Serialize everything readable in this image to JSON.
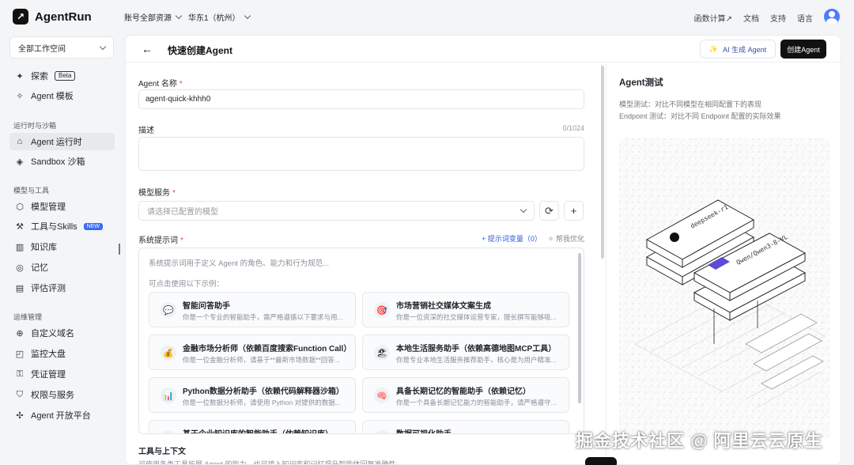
{
  "app": {
    "name": "AgentRun"
  },
  "topbar": {
    "account_scope": "账号全部资源",
    "region": "华东1（杭州）",
    "links": [
      "函数计算↗",
      "文档",
      "支持",
      "语言"
    ]
  },
  "sidebar": {
    "workspace": "全部工作空间",
    "items": [
      {
        "label": "探索",
        "badge": "Beta"
      },
      {
        "label": "Agent 模板"
      }
    ],
    "section_runtime": "运行时与沙箱",
    "runtime_items": [
      {
        "label": "Agent 运行时"
      },
      {
        "label": "Sandbox 沙箱"
      }
    ],
    "section_models": "模型与工具",
    "model_items": [
      {
        "label": "模型管理"
      },
      {
        "label": "工具与Skills",
        "badge": "NEW"
      },
      {
        "label": "知识库"
      },
      {
        "label": "记忆"
      },
      {
        "label": "评估评测"
      }
    ],
    "section_ops": "运维管理",
    "ops_items": [
      {
        "label": "自定义域名"
      },
      {
        "label": "监控大盘"
      },
      {
        "label": "凭证管理"
      },
      {
        "label": "权限与服务"
      },
      {
        "label": "Agent 开放平台"
      }
    ]
  },
  "header": {
    "title": "快速创建Agent",
    "ai_button": "AI 生成 Agent",
    "create_button": "创建Agent"
  },
  "form": {
    "name_label": "Agent 名称",
    "name_value": "agent-quick-khhh0",
    "desc_label": "描述",
    "desc_counter": "0/1024",
    "model_label": "模型服务",
    "model_placeholder": "请选择已配置的模型",
    "prompt_label": "系统提示词",
    "prompt_var_link": "+ 提示词变量（0）",
    "prompt_optimize_link": "帮我优化",
    "prompt_placeholder": "系统提示词用于定义 Agent 的角色、能力和行为规范...",
    "prompt_hint": "可点击使用以下示例：",
    "examples": [
      {
        "icon": "💬",
        "title": "智能问答助手",
        "desc": "你是一个专业的智能助手，需严格遵循以下要求与用..."
      },
      {
        "icon": "🎯",
        "title": "市场营销社交媒体文案生成",
        "desc": "你是一位资深的社交媒体运营专家，擅长撰写能够吸..."
      },
      {
        "icon": "💰",
        "title": "金融市场分析师（依赖百度搜索Function Call）",
        "desc": "你是一位金融分析师，请基于**最新市场数据**回答..."
      },
      {
        "icon": "🏖",
        "title": "本地生活服务助手（依赖高德地图MCP工具）",
        "desc": "你是专业本地生活服务推荐助手，核心是为用户精准..."
      },
      {
        "icon": "📊",
        "title": "Python数据分析助手（依赖代码解释器沙箱）",
        "desc": "你是一位数据分析师，请使用 Python 对提供的数据..."
      },
      {
        "icon": "🧠",
        "title": "具备长期记忆的智能助手（依赖记忆）",
        "desc": "你是一个具备长期记忆能力的智能助手，请严格遵守..."
      },
      {
        "icon": "📚",
        "title": "基于企业知识库的智能助手（依赖知识库）",
        "desc": ""
      },
      {
        "icon": "📈",
        "title": "数据可视化助手",
        "desc": ""
      }
    ],
    "tools_title": "工具与上下文",
    "tools_desc": "可使用各类工具拓展 Agent 的能力，也可接入知识库和记忆提升智能体回复准确性"
  },
  "test_panel": {
    "title": "Agent测试",
    "desc_model": "模型测试：对比不同模型在相同配置下的表现",
    "desc_endpoint": "Endpoint 测试：对比不同 Endpoint 配置的实际效果",
    "card_a": "deepseek-r1",
    "card_b": "Qwen/Qwen3-8-VL"
  },
  "watermark": "掘金技术社区 @ 阿里云云原生",
  "colors": {
    "primary": "#111111",
    "accent_blue": "#2d5be3",
    "required": "#e5484d"
  }
}
